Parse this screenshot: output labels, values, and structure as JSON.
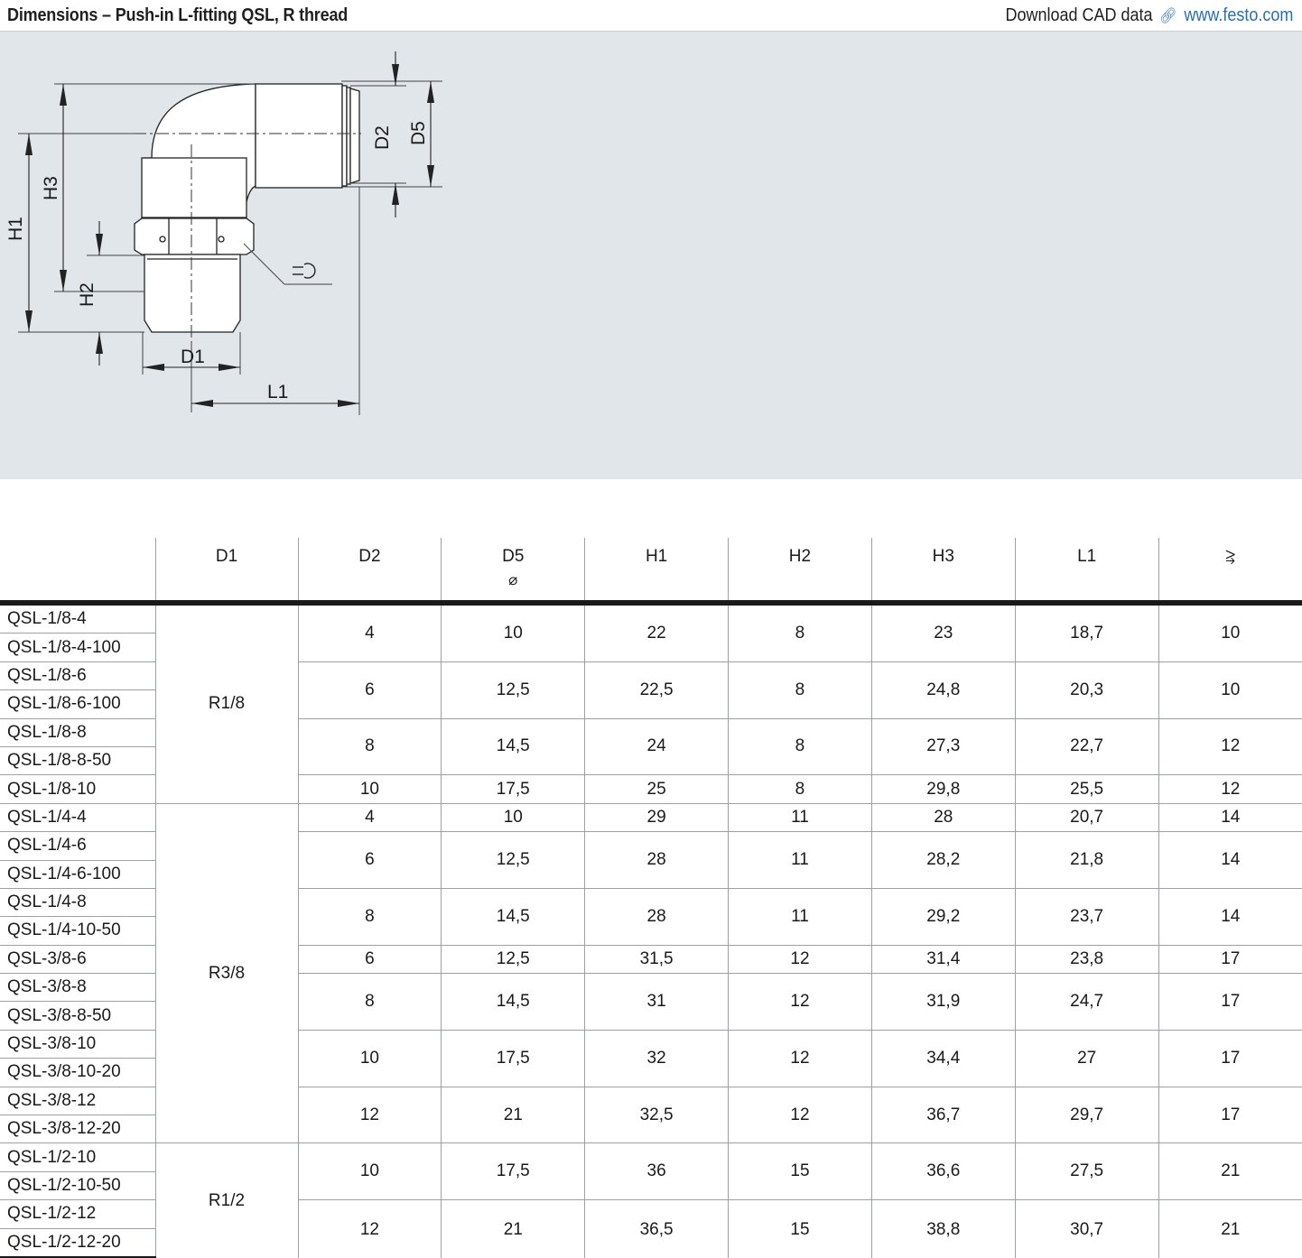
{
  "header": {
    "title": "Dimensions – Push-in L-fitting QSL, R thread",
    "download_label": "Download CAD data",
    "link_icon": "link-icon",
    "link_text": "www.festo.com"
  },
  "drawing": {
    "labels": {
      "h1": "H1",
      "h2": "H2",
      "h3": "H3",
      "d1": "D1",
      "d2": "D2",
      "d5": "D5",
      "l1": "L1"
    },
    "wrench_icon": "wrench-icon"
  },
  "table": {
    "headers": [
      "",
      "D1",
      "D2",
      "D5",
      "H1",
      "H2",
      "H3",
      "L1",
      "⥸"
    ],
    "d5_symbol": "⌀",
    "groups": [
      {
        "d1": "R1/8",
        "rows": [
          {
            "parts": [
              "QSL-1/8-4",
              "QSL-1/8-4-100"
            ],
            "d2": "4",
            "d5": "10",
            "h1": "22",
            "h2": "8",
            "h3": "23",
            "l1": "18,7",
            "sw": "10"
          },
          {
            "parts": [
              "QSL-1/8-6",
              "QSL-1/8-6-100"
            ],
            "d2": "6",
            "d5": "12,5",
            "h1": "22,5",
            "h2": "8",
            "h3": "24,8",
            "l1": "20,3",
            "sw": "10"
          },
          {
            "parts": [
              "QSL-1/8-8",
              "QSL-1/8-8-50"
            ],
            "d2": "8",
            "d5": "14,5",
            "h1": "24",
            "h2": "8",
            "h3": "27,3",
            "l1": "22,7",
            "sw": "12"
          },
          {
            "parts": [
              "QSL-1/8-10"
            ],
            "d2": "10",
            "d5": "17,5",
            "h1": "25",
            "h2": "8",
            "h3": "29,8",
            "l1": "25,5",
            "sw": "12"
          }
        ]
      },
      {
        "d1": "R3/8",
        "rows": [
          {
            "parts": [
              "QSL-1/4-4"
            ],
            "d2": "4",
            "d5": "10",
            "h1": "29",
            "h2": "11",
            "h3": "28",
            "l1": "20,7",
            "sw": "14"
          },
          {
            "parts": [
              "QSL-1/4-6",
              "QSL-1/4-6-100"
            ],
            "d2": "6",
            "d5": "12,5",
            "h1": "28",
            "h2": "11",
            "h3": "28,2",
            "l1": "21,8",
            "sw": "14"
          },
          {
            "parts": [
              "QSL-1/4-8",
              "QSL-1/4-10-50"
            ],
            "d2": "8",
            "d5": "14,5",
            "h1": "28",
            "h2": "11",
            "h3": "29,2",
            "l1": "23,7",
            "sw": "14"
          },
          {
            "parts": [
              "QSL-3/8-6"
            ],
            "d2": "6",
            "d5": "12,5",
            "h1": "31,5",
            "h2": "12",
            "h3": "31,4",
            "l1": "23,8",
            "sw": "17"
          },
          {
            "parts": [
              "QSL-3/8-8",
              "QSL-3/8-8-50"
            ],
            "d2": "8",
            "d5": "14,5",
            "h1": "31",
            "h2": "12",
            "h3": "31,9",
            "l1": "24,7",
            "sw": "17"
          },
          {
            "parts": [
              "QSL-3/8-10",
              "QSL-3/8-10-20"
            ],
            "d2": "10",
            "d5": "17,5",
            "h1": "32",
            "h2": "12",
            "h3": "34,4",
            "l1": "27",
            "sw": "17"
          },
          {
            "parts": [
              "QSL-3/8-12",
              "QSL-3/8-12-20"
            ],
            "d2": "12",
            "d5": "21",
            "h1": "32,5",
            "h2": "12",
            "h3": "36,7",
            "l1": "29,7",
            "sw": "17"
          }
        ]
      },
      {
        "d1": "R1/2",
        "rows": [
          {
            "parts": [
              "QSL-1/2-10",
              "QSL-1/2-10-50"
            ],
            "d2": "10",
            "d5": "17,5",
            "h1": "36",
            "h2": "15",
            "h3": "36,6",
            "l1": "27,5",
            "sw": "21"
          },
          {
            "parts": [
              "QSL-1/2-12",
              "QSL-1/2-12-20"
            ],
            "d2": "12",
            "d5": "21",
            "h1": "36,5",
            "h2": "15",
            "h3": "38,8",
            "l1": "30,7",
            "sw": "21"
          }
        ]
      }
    ]
  }
}
